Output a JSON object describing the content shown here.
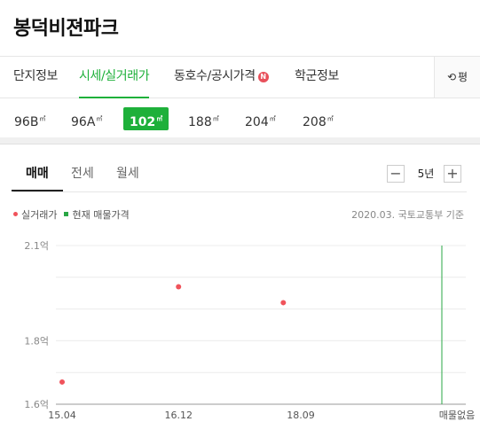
{
  "page_title": "봉덕비젼파크",
  "tabs": [
    {
      "label": "단지정보"
    },
    {
      "label": "시세/실거래가",
      "active": true
    },
    {
      "label": "동호수/공시가격",
      "badge": "N"
    },
    {
      "label": "학군정보"
    }
  ],
  "refresh": {
    "icon": "refresh-icon",
    "label": "평"
  },
  "areas": [
    {
      "label": "96B",
      "unit": "㎡"
    },
    {
      "label": "96A",
      "unit": "㎡"
    },
    {
      "label": "102",
      "unit": "㎡",
      "active": true
    },
    {
      "label": "188",
      "unit": "㎡"
    },
    {
      "label": "204",
      "unit": "㎡"
    },
    {
      "label": "208",
      "unit": "㎡"
    }
  ],
  "subtabs": [
    {
      "label": "매매",
      "active": true
    },
    {
      "label": "전세"
    },
    {
      "label": "월세"
    }
  ],
  "period": {
    "minus": "−",
    "value": "5년",
    "plus": "+"
  },
  "legend": {
    "actual": "실거래가",
    "current": "현재 매물가격"
  },
  "source": "2020.03. 국토교통부 기준",
  "colors": {
    "accent": "#1eb03a",
    "point": "#f0535b",
    "current_line": "#2aa745"
  },
  "chart_data": {
    "type": "scatter",
    "y_ticks": [
      "2.1억",
      "1.8억",
      "1.6억"
    ],
    "x_ticks": [
      "15.04",
      "16.12",
      "18.09"
    ],
    "x_end_label": "매물없음",
    "ylim": [
      1.6,
      2.1
    ],
    "grid": true,
    "series": [
      {
        "name": "실거래가",
        "points": [
          {
            "x": "15.04",
            "y": 1.67
          },
          {
            "x": "16.12",
            "y": 1.97
          },
          {
            "x": "18.06",
            "y": 1.92
          }
        ]
      }
    ]
  }
}
